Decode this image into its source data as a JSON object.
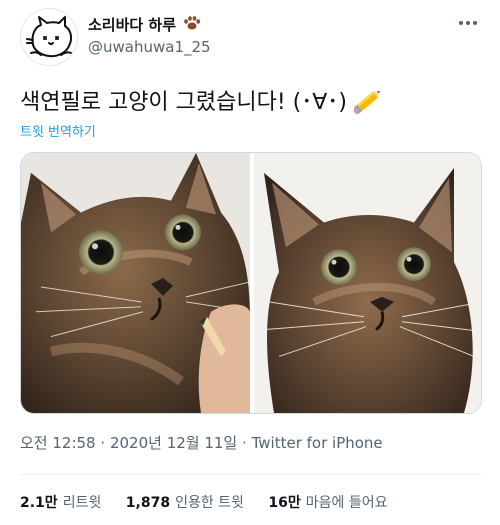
{
  "user": {
    "display_name": "소리바다 하루",
    "handle": "@uwahuwa1_25",
    "avatar_icon": "cat-avatar-icon",
    "name_badge_icon": "paw-print-icon"
  },
  "tweet": {
    "text": "색연필로 고양이 그렸습니다! (･∀･)",
    "trailing_emoji_icon": "pencil-emoji-icon",
    "translate_label": "트윗 번역하기"
  },
  "media": {
    "photos": [
      {
        "alt_icon": "cat-photo-being-drawn"
      },
      {
        "alt_icon": "cat-photo-finished-drawing"
      }
    ]
  },
  "meta": {
    "time": "오전 12:58",
    "separator": "·",
    "date": "2020년 12월 11일",
    "source": "Twitter for iPhone"
  },
  "stats": {
    "retweets_value": "2.1만",
    "retweets_label": "리트윗",
    "quotes_value": "1,878",
    "quotes_label": "인용한 트윗",
    "likes_value": "16만",
    "likes_label": "마음에 들어요"
  },
  "colors": {
    "accent": "#1d9bf0",
    "text_primary": "#0f1419",
    "text_secondary": "#536471",
    "paw_badge": "#8b4a2b"
  }
}
